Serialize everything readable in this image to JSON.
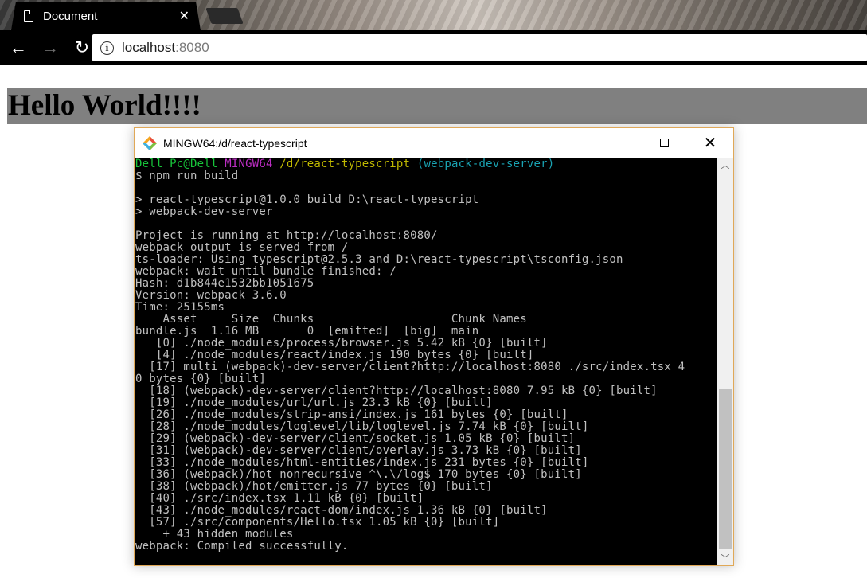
{
  "browser": {
    "tab_title": "Document",
    "tab_close": "✕",
    "back": "←",
    "forward": "→",
    "reload": "↻",
    "info": "i",
    "url_host": "localhost",
    "url_port": ":8080"
  },
  "page": {
    "heading": "Hello World!!!!"
  },
  "terminal": {
    "title": "MINGW64:/d/react-typescript",
    "prompt": {
      "user": "Dell Pc@Dell",
      "shell": "MINGW64",
      "path": "/d/react-typescript",
      "branch": "(webpack-dev-server)"
    },
    "command": "$ npm run build",
    "output": [
      "",
      "> react-typescript@1.0.0 build D:\\react-typescript",
      "> webpack-dev-server",
      "",
      "Project is running at http://localhost:8080/",
      "webpack output is served from /",
      "ts-loader: Using typescript@2.5.3 and D:\\react-typescript\\tsconfig.json",
      "webpack: wait until bundle finished: /",
      "Hash: d1b844e1532bb1051675",
      "Version: webpack 3.6.0",
      "Time: 25155ms",
      "    Asset     Size  Chunks                    Chunk Names",
      "bundle.js  1.16 MB       0  [emitted]  [big]  main",
      "   [0] ./node_modules/process/browser.js 5.42 kB {0} [built]",
      "   [4] ./node_modules/react/index.js 190 bytes {0} [built]",
      "  [17] multi (webpack)-dev-server/client?http://localhost:8080 ./src/index.tsx 4",
      "0 bytes {0} [built]",
      "  [18] (webpack)-dev-server/client?http://localhost:8080 7.95 kB {0} [built]",
      "  [19] ./node_modules/url/url.js 23.3 kB {0} [built]",
      "  [26] ./node_modules/strip-ansi/index.js 161 bytes {0} [built]",
      "  [28] ./node_modules/loglevel/lib/loglevel.js 7.74 kB {0} [built]",
      "  [29] (webpack)-dev-server/client/socket.js 1.05 kB {0} [built]",
      "  [31] (webpack)-dev-server/client/overlay.js 3.73 kB {0} [built]",
      "  [33] ./node_modules/html-entities/index.js 231 bytes {0} [built]",
      "  [36] (webpack)/hot nonrecursive ^\\.\\/log$ 170 bytes {0} [built]",
      "  [38] (webpack)/hot/emitter.js 77 bytes {0} [built]",
      "  [40] ./src/index.tsx 1.11 kB {0} [built]",
      "  [43] ./node_modules/react-dom/index.js 1.36 kB {0} [built]",
      "  [57] ./src/components/Hello.tsx 1.05 kB {0} [built]",
      "    + 43 hidden modules",
      "webpack: Compiled successfully."
    ],
    "scroll_up": "︿",
    "scroll_down": "﹀"
  },
  "colors": {
    "prompt_user": "#17c43a",
    "prompt_shell": "#bd2ec4",
    "prompt_path": "#c0b900",
    "prompt_branch": "#1aa3b3",
    "heading_bg": "#808080",
    "window_border": "#e0a857"
  },
  "icons": {
    "tab": "document-icon",
    "terminal": "git-bash-icon",
    "address": "info-icon"
  }
}
